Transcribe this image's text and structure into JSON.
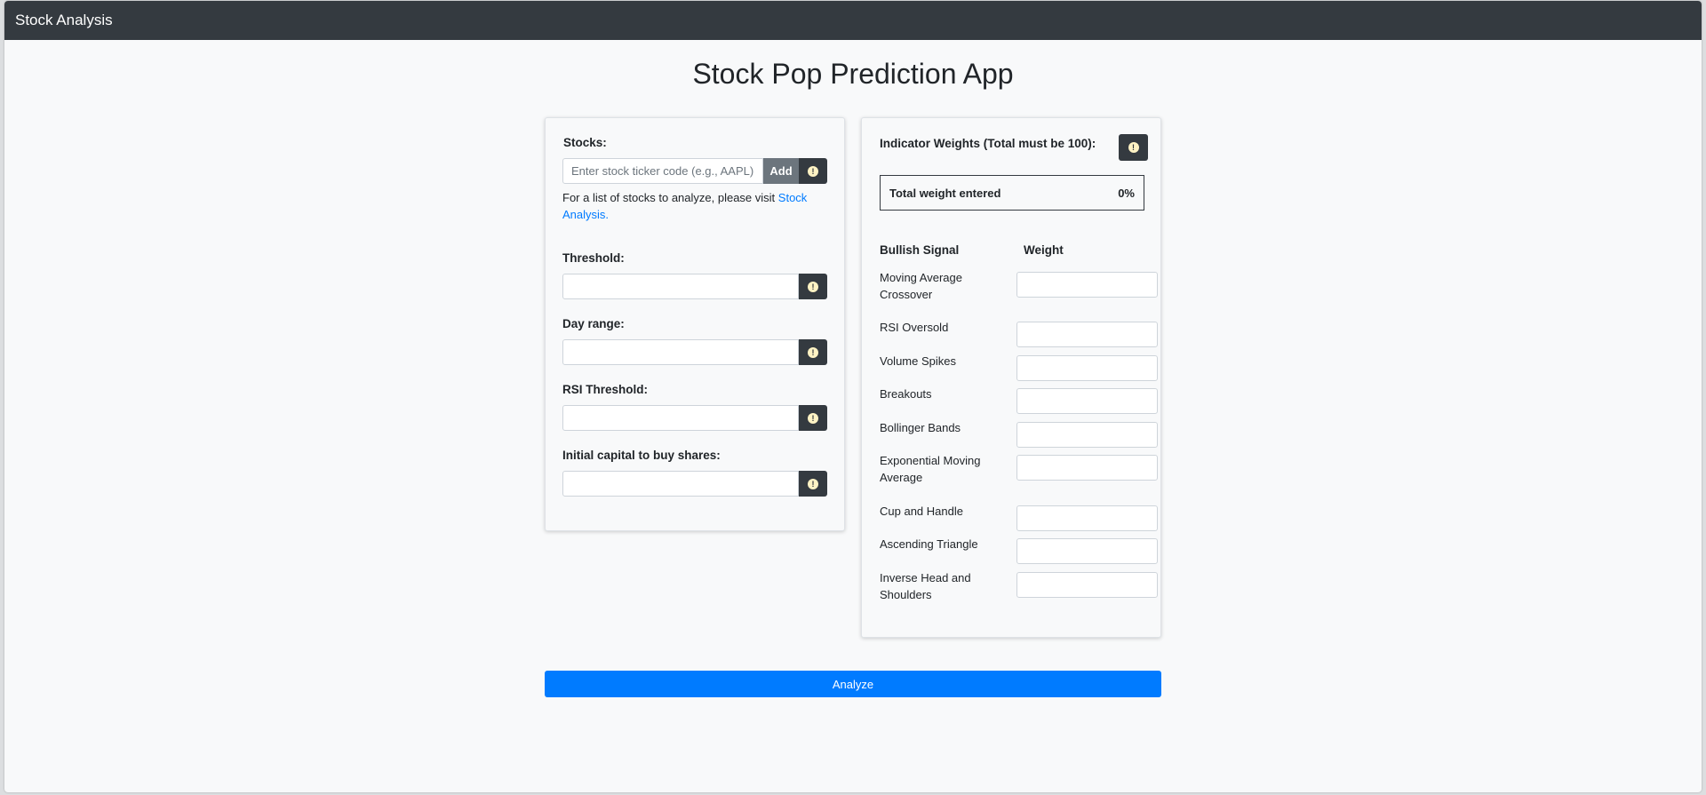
{
  "navbar": {
    "brand": "Stock Analysis"
  },
  "page": {
    "title": "Stock Pop Prediction App"
  },
  "left_panel": {
    "stocks_label": "Stocks:",
    "stock_input_placeholder": "Enter stock ticker code (e.g., AAPL)",
    "add_label": "Add",
    "help_prefix": "For a list of stocks to analyze, please visit ",
    "help_link": "Stock Analysis.",
    "threshold_label": "Threshold:",
    "day_range_label": "Day range:",
    "rsi_threshold_label": "RSI Threshold:",
    "capital_label": "Initial capital to buy shares:",
    "info_glyph": "!"
  },
  "right_panel": {
    "title": "Indicator Weights (Total must be 100):",
    "total_label": "Total weight entered",
    "total_value": "0%",
    "col_signal": "Bullish Signal",
    "col_weight": "Weight",
    "signals": [
      "Moving Average Crossover",
      "RSI Oversold",
      "Volume Spikes",
      "Breakouts",
      "Bollinger Bands",
      "Exponential Moving Average",
      "Cup and Handle",
      "Ascending Triangle",
      "Inverse Head and Shoulders"
    ]
  },
  "analyze_label": "Analyze",
  "colors": {
    "navbar": "#343a40",
    "primary": "#007bff",
    "secondary": "#6c757d",
    "info_icon": "#fff3c4"
  },
  "icons": {
    "info": "info-icon"
  }
}
